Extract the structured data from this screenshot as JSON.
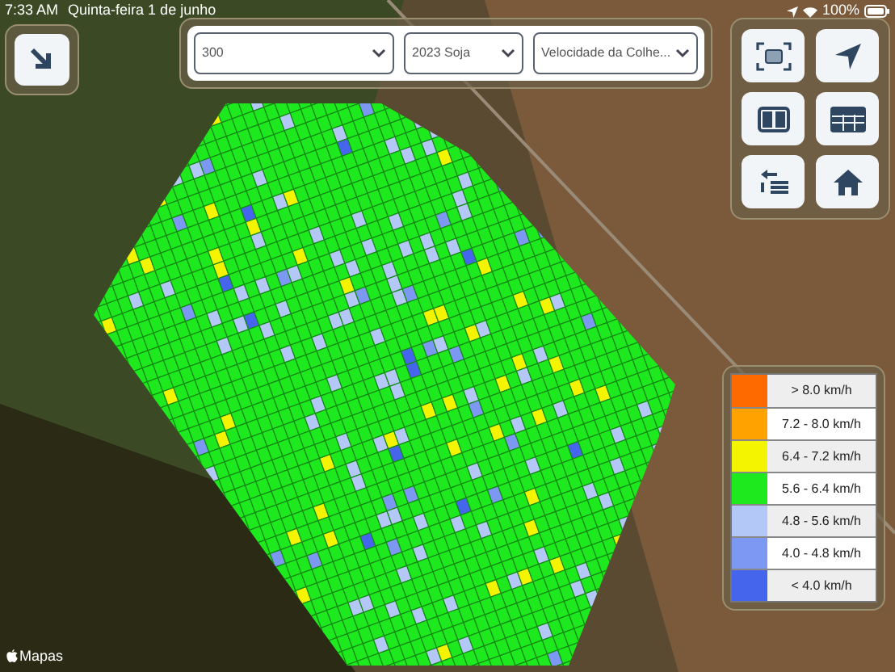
{
  "status_bar": {
    "time": "7:33 AM",
    "date": "Quinta-feira 1 de junho",
    "battery": "100%"
  },
  "filters": [
    {
      "value": "300"
    },
    {
      "value": "2023 Soja"
    },
    {
      "value": "Velocidade da Colhe..."
    }
  ],
  "legend": [
    {
      "label": "> 8.0 km/h",
      "color": "#ff6a00"
    },
    {
      "label": "7.2 - 8.0 km/h",
      "color": "#ffa200"
    },
    {
      "label": "6.4 - 7.2 km/h",
      "color": "#f4f400"
    },
    {
      "label": "5.6 - 6.4 km/h",
      "color": "#1ee81e"
    },
    {
      "label": "4.8 - 5.6 km/h",
      "color": "#b4c8f8"
    },
    {
      "label": "4.0 - 4.8 km/h",
      "color": "#7d98f2"
    },
    {
      "label": "< 4.0 km/h",
      "color": "#4566ec"
    }
  ],
  "map_attribution": "Mapas"
}
